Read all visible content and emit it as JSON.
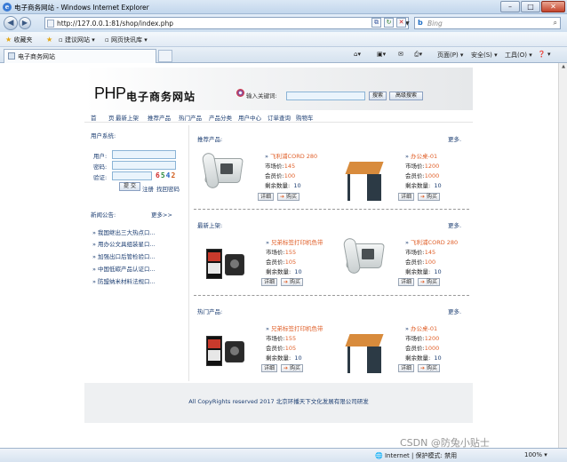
{
  "window": {
    "title": "电子商务网站 - Windows Internet Explorer",
    "min_glyph": "–",
    "max_glyph": "□",
    "close_glyph": "✕"
  },
  "address_bar": {
    "url": "http://127.0.0.1:81/shop/index.php",
    "search_placeholder": "Bing"
  },
  "favorites_bar": {
    "favorites_label": "收藏夹",
    "item1": "建议网站 ▾",
    "item2": "网页快讯库 ▾"
  },
  "tabs": [
    {
      "label": "电子商务网站"
    }
  ],
  "command_bar": {
    "page": "页面(P) ▾",
    "safety": "安全(S) ▾",
    "tools": "工具(O) ▾",
    "help": "❓ ▾"
  },
  "site": {
    "logo_php": "PHP",
    "logo_cn": "电子商务网站",
    "keyword_label": "输入关键词:",
    "search_button": "搜索",
    "advanced_search_button": "高级搜索",
    "menu": [
      "首",
      "页",
      "最新上架",
      "推荐产品",
      "热门产品",
      "产品分类",
      "用户中心",
      "订单查询",
      "购物车"
    ],
    "login": {
      "title": "用户系统:",
      "username_label": "用户:",
      "password_label": "密码:",
      "captcha_label": "验证:",
      "captcha_digits": [
        "6",
        "5",
        "4",
        "2"
      ],
      "submit_button": "提 交",
      "register_link": "注册",
      "forgot_link": "找回密码"
    },
    "news": {
      "title": "新闻公告:",
      "more": "更多>>",
      "items": [
        "» 我国继出三大热点口...",
        "» 用办公文具组装星口...",
        "» 加强出口后管检验口...",
        "» 中国低碳产品认证口...",
        "» 防盟纳米材料法规口..."
      ]
    },
    "sections": [
      {
        "title": "推荐产品:",
        "more": "更多.",
        "products": [
          {
            "name": "飞利浦CORD 280",
            "market_label": "市场价:",
            "market": "145",
            "member_label": "会员价:",
            "member": "100",
            "stock_label": "剩余数量:",
            "stock": "10",
            "detail": "详细",
            "buy": "购买",
            "image": "phone-image"
          },
          {
            "name": "办公桌-01",
            "market_label": "市场价:",
            "market": "1200",
            "member_label": "会员价:",
            "member": "1000",
            "stock_label": "剩余数量:",
            "stock": "10",
            "detail": "详细",
            "buy": "购买",
            "image": "desk-image"
          }
        ]
      },
      {
        "title": "最新上架:",
        "more": "更多.",
        "products": [
          {
            "name": "兄弟标签打印机色带",
            "market_label": "市场价:",
            "market": "155",
            "member_label": "会员价:",
            "member": "105",
            "stock_label": "剩余数量:",
            "stock": "10",
            "detail": "详细",
            "buy": "购买",
            "image": "ribbon-image"
          },
          {
            "name": "飞利浦CORD 280",
            "market_label": "市场价:",
            "market": "145",
            "member_label": "会员价:",
            "member": "100",
            "stock_label": "剩余数量:",
            "stock": "10",
            "detail": "详细",
            "buy": "购买",
            "image": "phone-image"
          }
        ]
      },
      {
        "title": "热门产品:",
        "more": "更多.",
        "products": [
          {
            "name": "兄弟标签打印机色带",
            "market_label": "市场价:",
            "market": "155",
            "member_label": "会员价:",
            "member": "105",
            "stock_label": "剩余数量:",
            "stock": "10",
            "detail": "详细",
            "buy": "购买",
            "image": "ribbon-image"
          },
          {
            "name": "办公桌-01",
            "market_label": "市场价:",
            "market": "1200",
            "member_label": "会员价:",
            "member": "1000",
            "stock_label": "剩余数量:",
            "stock": "10",
            "detail": "详细",
            "buy": "购买",
            "image": "desk-image"
          }
        ]
      }
    ],
    "footer": "All CopyRights reserved 2017 北京环播天下文化发展有限公司研发"
  },
  "status_bar": {
    "zone": "Internet | 保护模式: 禁用",
    "zoom": "100% ▾"
  },
  "watermark": "CSDN @防兔小贴士",
  "colors": {
    "link": "#1c3e72",
    "price": "#e0602a",
    "input_bg": "#eaf4fc"
  }
}
